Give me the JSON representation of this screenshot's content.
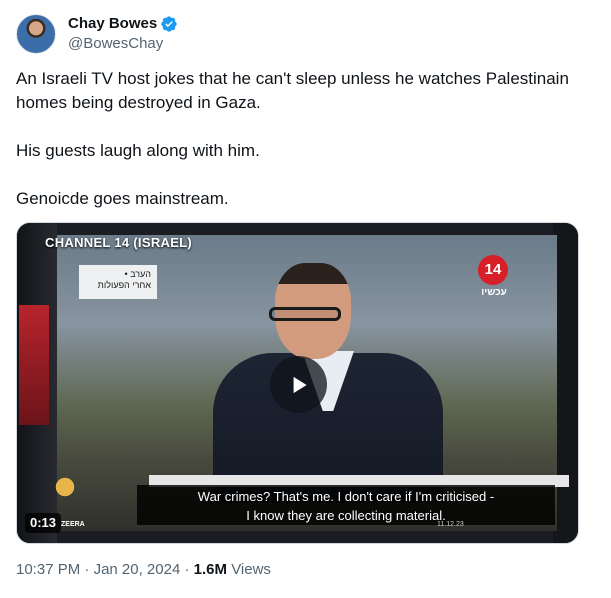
{
  "author": {
    "display_name": "Chay Bowes",
    "handle": "@BowesChay",
    "verified": true
  },
  "tweet": {
    "paragraphs": [
      "An Israeli TV host jokes that he can't sleep unless he watches Palestinain homes being destroyed in Gaza.",
      "His guests laugh along with him.",
      "Genoicde goes mainstream."
    ]
  },
  "video": {
    "channel_label": "CHANNEL 14 (ISRAEL)",
    "hebrew_corner_box": "• הערב\nאחרי הפעולות",
    "channel_badge": "14",
    "channel_badge_sub": "עכשיו",
    "subtitle_line1": "War crimes? That's me. I don't care if I'm criticised -",
    "subtitle_line2": "I know they are collecting material.",
    "ticker": "11.12.23",
    "network_logo_text": "ZEERA",
    "duration": "0:13"
  },
  "meta": {
    "time": "10:37 PM",
    "date": "Jan 20, 2024",
    "separator": "·",
    "views_count": "1.6M",
    "views_label": "Views"
  },
  "colors": {
    "verified_blue": "#1d9bf0",
    "secondary_text": "#536471",
    "primary_text": "#0f1419",
    "channel_red": "#d61f26"
  }
}
